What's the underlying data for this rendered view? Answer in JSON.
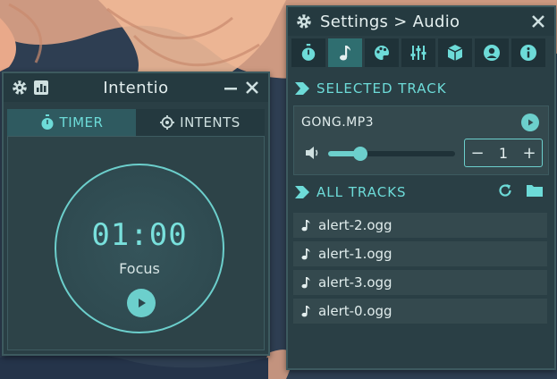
{
  "main_window": {
    "title": "Intentio",
    "tabs": [
      {
        "label": "TIMER",
        "icon": "stopwatch-icon",
        "active": true
      },
      {
        "label": "INTENTS",
        "icon": "crosshair-icon",
        "active": false
      }
    ],
    "timer": {
      "time": "01:00",
      "mode": "Focus"
    }
  },
  "settings_window": {
    "title": "Settings > Audio",
    "categories": [
      {
        "icon": "stopwatch-icon",
        "active": false
      },
      {
        "icon": "music-note-icon",
        "active": true
      },
      {
        "icon": "palette-icon",
        "active": false
      },
      {
        "icon": "sliders-icon",
        "active": false
      },
      {
        "icon": "cube-icon",
        "active": false
      },
      {
        "icon": "user-icon",
        "active": false
      },
      {
        "icon": "info-icon",
        "active": false
      }
    ],
    "selected_section": "SELECTED TRACK",
    "selected_track": {
      "name": "GONG.MP3",
      "volume": 0.25,
      "repeat": "1"
    },
    "all_section": "ALL TRACKS",
    "tracks": [
      "alert-2.ogg",
      "alert-1.ogg",
      "alert-3.ogg",
      "alert-0.ogg"
    ]
  },
  "colors": {
    "accent": "#6ccfcc",
    "window": "#2a3f45",
    "titlebar": "#253a40"
  }
}
